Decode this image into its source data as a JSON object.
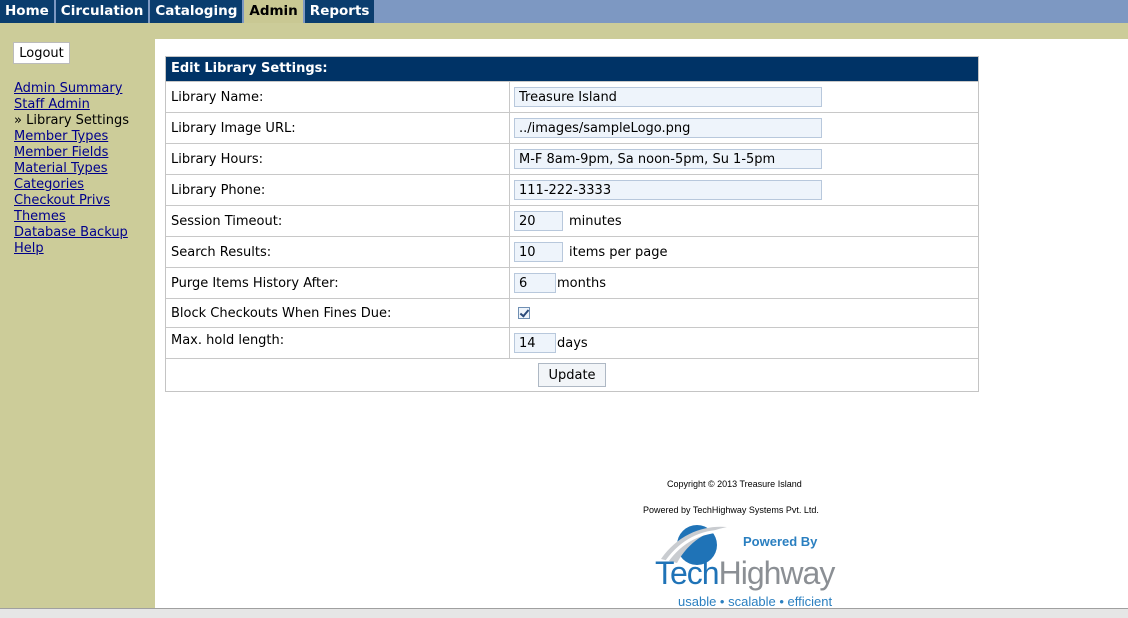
{
  "nav": {
    "tabs": [
      {
        "label": "Home"
      },
      {
        "label": "Circulation"
      },
      {
        "label": "Cataloging"
      },
      {
        "label": "Admin",
        "active": true
      },
      {
        "label": "Reports"
      }
    ]
  },
  "sidebar": {
    "logout_label": "Logout",
    "links": [
      "Admin Summary",
      "Staff Admin",
      "» Library Settings",
      "Member Types",
      "Member Fields",
      "Material Types",
      "Categories",
      "Checkout Privs",
      "Themes",
      "Database Backup",
      "Help"
    ]
  },
  "form": {
    "title": "Edit Library Settings:",
    "library_name": {
      "label": "Library Name:",
      "value": "Treasure Island"
    },
    "image_url": {
      "label": "Library Image URL:",
      "value": "../images/sampleLogo.png"
    },
    "hours": {
      "label": "Library Hours:",
      "value": "M-F 8am-9pm, Sa noon-5pm, Su 1-5pm"
    },
    "phone": {
      "label": "Library Phone:",
      "value": "111-222-3333"
    },
    "session_timeout": {
      "label": "Session Timeout:",
      "value": "20",
      "unit": "minutes"
    },
    "search_results": {
      "label": "Search Results:",
      "value": "10",
      "unit": "items per page"
    },
    "purge_history": {
      "label": "Purge Items History After:",
      "value": "6",
      "unit": "months"
    },
    "block_checkouts": {
      "label": "Block Checkouts When Fines Due:",
      "checked": true
    },
    "max_hold": {
      "label": "Max. hold length:",
      "value": "14",
      "unit": "days"
    },
    "update_label": "Update"
  },
  "footer": {
    "copyright": "Copyright © 2013 Treasure Island",
    "powered_by_text": "Powered by TechHighway Systems Pvt. Ltd.",
    "logo_powered": "Powered By",
    "logo_tech": "Tech",
    "logo_highway": "Highway",
    "logo_tagline": "usable • scalable • efficient"
  },
  "colors": {
    "nav_tab": "#0a3d6e",
    "nav_active": "#c9c893",
    "sidebar_bg": "#cccc99",
    "header_blue": "#003366",
    "link": "#00008b"
  }
}
